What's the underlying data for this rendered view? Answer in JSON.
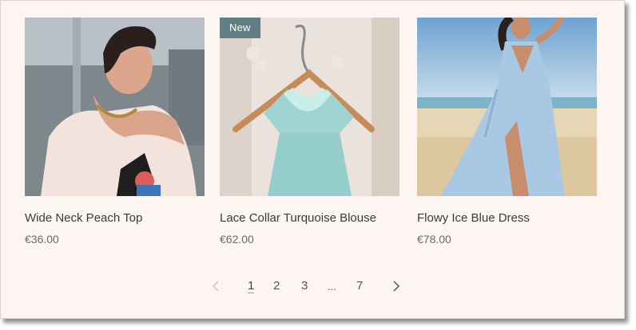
{
  "products": [
    {
      "name": "Wide Neck Peach Top",
      "price": "€36.00",
      "image_icon": "product-photo-peach-top"
    },
    {
      "name": "Lace Collar Turquoise Blouse",
      "price": "€62.00",
      "badge": "New",
      "image_icon": "product-photo-turquoise-blouse"
    },
    {
      "name": "Flowy Ice Blue Dress",
      "price": "€78.00",
      "image_icon": "product-photo-blue-dress"
    }
  ],
  "pagination": {
    "prev_icon": "chevron-left-icon",
    "next_icon": "chevron-right-icon",
    "pages": [
      "1",
      "2",
      "3",
      "...",
      "7"
    ],
    "current": "1"
  },
  "colors": {
    "background": "#fcf5f1",
    "badge": "#5f7f84",
    "current_page_underline": "#c58d8d"
  }
}
